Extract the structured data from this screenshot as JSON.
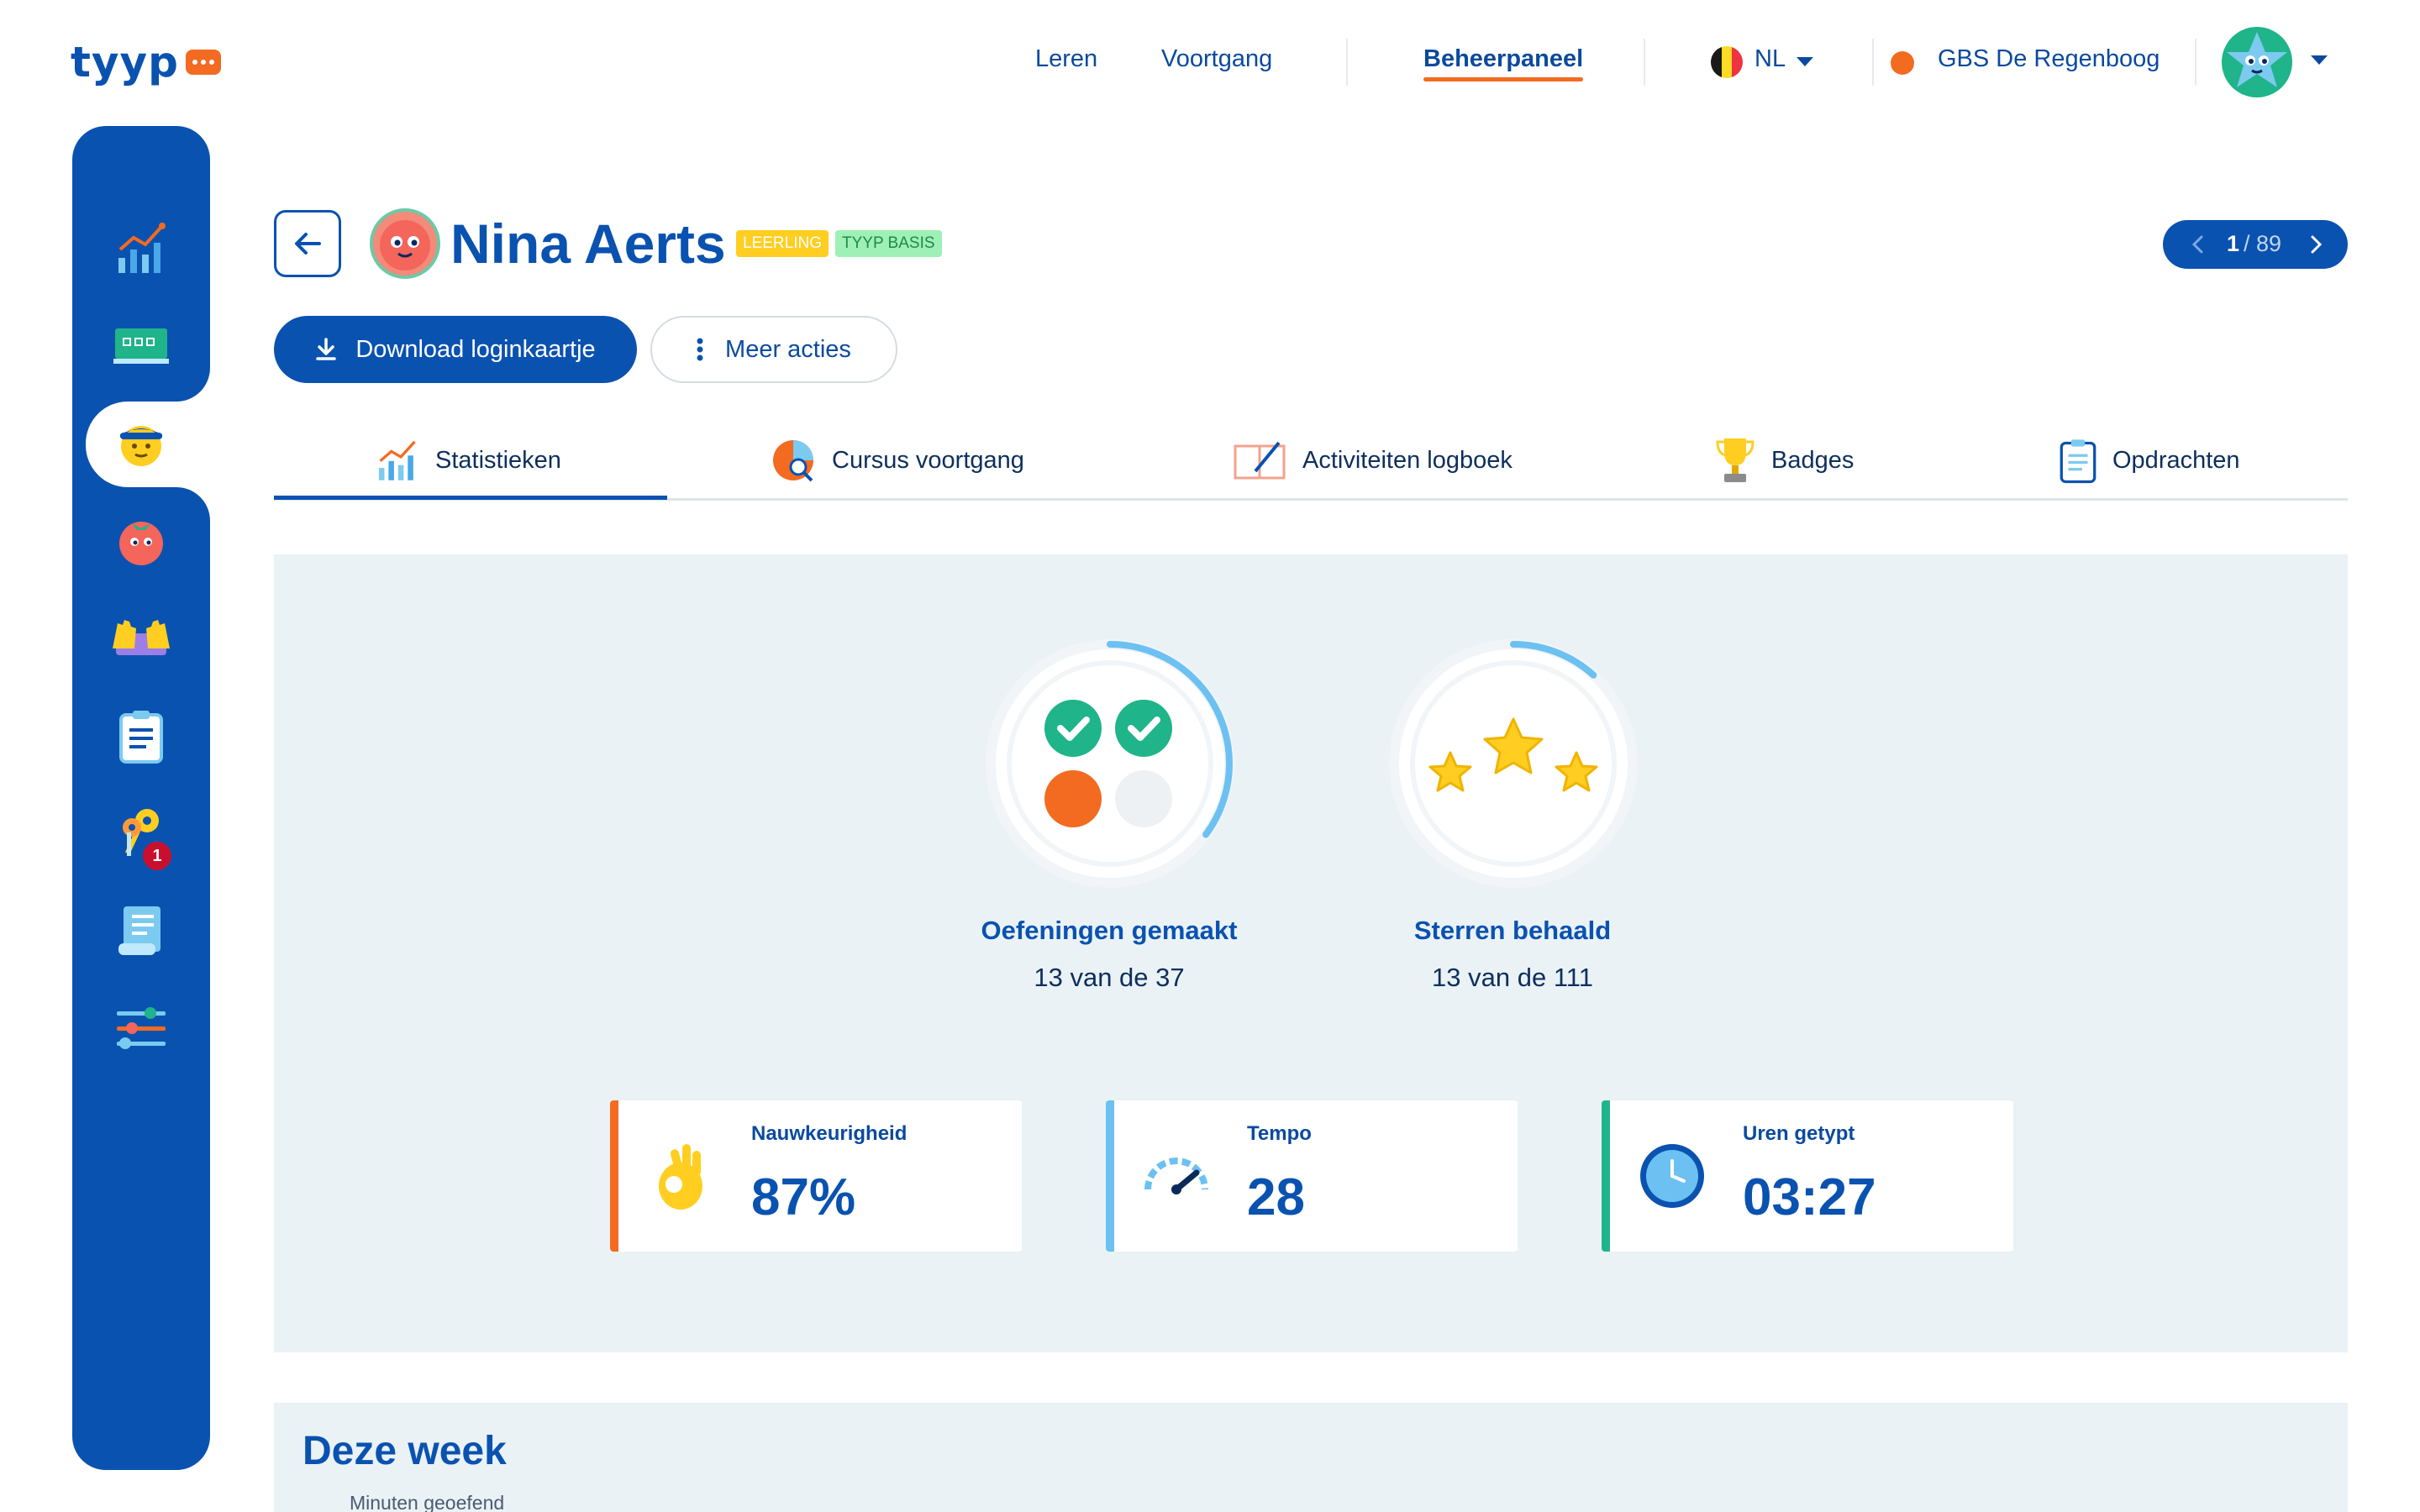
{
  "logo": {
    "text": "tyyp"
  },
  "nav": {
    "items": [
      {
        "label": "Leren"
      },
      {
        "label": "Voortgang"
      },
      {
        "label": "Beheerpaneel",
        "active": true
      }
    ],
    "language": "NL",
    "school": "GBS De Regenboog"
  },
  "sidebar": {
    "items": [
      {
        "icon": "chart-icon"
      },
      {
        "icon": "classroom-board-icon"
      },
      {
        "icon": "student-icon",
        "active": true
      },
      {
        "icon": "tomato-icon"
      },
      {
        "icon": "hands-keyboard-icon"
      },
      {
        "icon": "clipboard-icon"
      },
      {
        "icon": "keys-icon",
        "badge": "1"
      },
      {
        "icon": "receipt-icon"
      },
      {
        "icon": "sliders-icon"
      }
    ]
  },
  "student": {
    "name": "Nina Aerts",
    "tag_role": "LEERLING",
    "tag_plan": "TYYP BASIS"
  },
  "pager": {
    "current": "1",
    "total": "/ 89"
  },
  "actions": {
    "download_label": "Download loginkaartje",
    "more_label": "Meer acties"
  },
  "tabs": [
    {
      "label": "Statistieken",
      "icon": "chart-icon",
      "active": true
    },
    {
      "label": "Cursus voortgang",
      "icon": "pie-search-icon"
    },
    {
      "label": "Activiteiten logboek",
      "icon": "notebook-pen-icon"
    },
    {
      "label": "Badges",
      "icon": "trophy-icon"
    },
    {
      "label": "Opdrachten",
      "icon": "clipboard-icon"
    }
  ],
  "progress": {
    "exercises": {
      "label": "Oefeningen gemaakt",
      "summary": "13 van de 37",
      "done": 13,
      "total": 37
    },
    "stars": {
      "label": "Sterren behaald",
      "summary": "13 van de 111",
      "done": 13,
      "total": 111
    }
  },
  "stats": {
    "accuracy": {
      "label": "Nauwkeurigheid",
      "value": "87%",
      "color": "#f26b21",
      "icon": "ok-hand-icon"
    },
    "speed": {
      "label": "Tempo",
      "value": "28",
      "color": "#6cc1f2",
      "icon": "speedometer-icon"
    },
    "hours": {
      "label": "Uren getypt",
      "value": "03:27",
      "color": "#1fb48a",
      "icon": "clock-icon"
    }
  },
  "week": {
    "title": "Deze week",
    "subtitle": "Minuten geoefend"
  },
  "colors": {
    "primary": "#0a52b0",
    "accent": "#f26b21",
    "panel": "#eaf2f6"
  }
}
